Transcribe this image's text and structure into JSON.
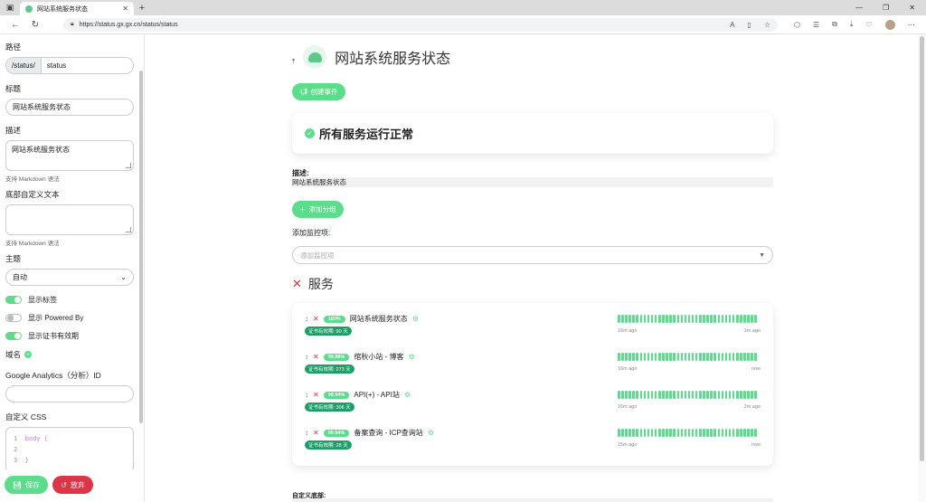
{
  "browser": {
    "tab_title": "网站系统服务状态",
    "tab_close": "✕",
    "new_tab": "+",
    "url": "https://status.gx.gx.cn/status/status",
    "window_controls": [
      "—",
      "❐",
      "✕"
    ]
  },
  "sidebar": {
    "path_label": "路径",
    "path_prefix": "/status/",
    "path_value": "status",
    "title_label": "标题",
    "title_value": "网站系统服务状态",
    "desc_label": "描述",
    "desc_value": "网站系统服务状态",
    "markdown_hint": "支持 Markdown 语法",
    "footer_label": "底部自定义文本",
    "footer_value": "",
    "footer_hint": "支持 Markdown 语法",
    "theme_label": "主题",
    "theme_value": "自动",
    "toggles": [
      {
        "label": "显示标签",
        "on": true
      },
      {
        "label": "显示 Powered By",
        "on": false
      },
      {
        "label": "显示证书有效期",
        "on": true
      }
    ],
    "domain_label": "域名",
    "ga_label": "Google Analytics（分析）ID",
    "ga_value": "",
    "css_label": "自定义 CSS",
    "css_lines": [
      {
        "num": "1",
        "text": "body {"
      },
      {
        "num": "2",
        "text": ""
      },
      {
        "num": "3",
        "text": "}"
      }
    ],
    "save_label": "保存",
    "discard_label": "放弃"
  },
  "main": {
    "site_title": "网站系统服务状态",
    "create_event_label": "创建事件",
    "overall_status": "所有服务运行正常",
    "desc_label": "描述:",
    "desc_value": "网站系统服务状态",
    "add_group_label": "添加分组",
    "add_monitor_label": "添加监控项:",
    "add_monitor_placeholder": "添加监控项",
    "group_title": "服务",
    "services": [
      {
        "uptime": "100%",
        "name": "网站系统服务状态",
        "cert": "证书有效期: 90 天",
        "t_from": "16m ago",
        "t_to": "1m ago"
      },
      {
        "uptime": "99.88%",
        "name": "绾秋小站 - 博客",
        "cert": "证书有效期: 273 天",
        "t_from": "16m ago",
        "t_to": "now"
      },
      {
        "uptime": "99.94%",
        "name": "API(+) - API站",
        "cert": "证书有效期: 306 天",
        "t_from": "16m ago",
        "t_to": "2m ago"
      },
      {
        "uptime": "99.94%",
        "name": "备案查询 - ICP查询站",
        "cert": "证书有效期: 28 天",
        "t_from": "15m ago",
        "t_to": "now"
      }
    ],
    "custom_footer_label": "自定义底部:"
  },
  "colors": {
    "accent": "#5cdd8b",
    "danger": "#dc3545",
    "cert_badge": "#1f9d66"
  }
}
